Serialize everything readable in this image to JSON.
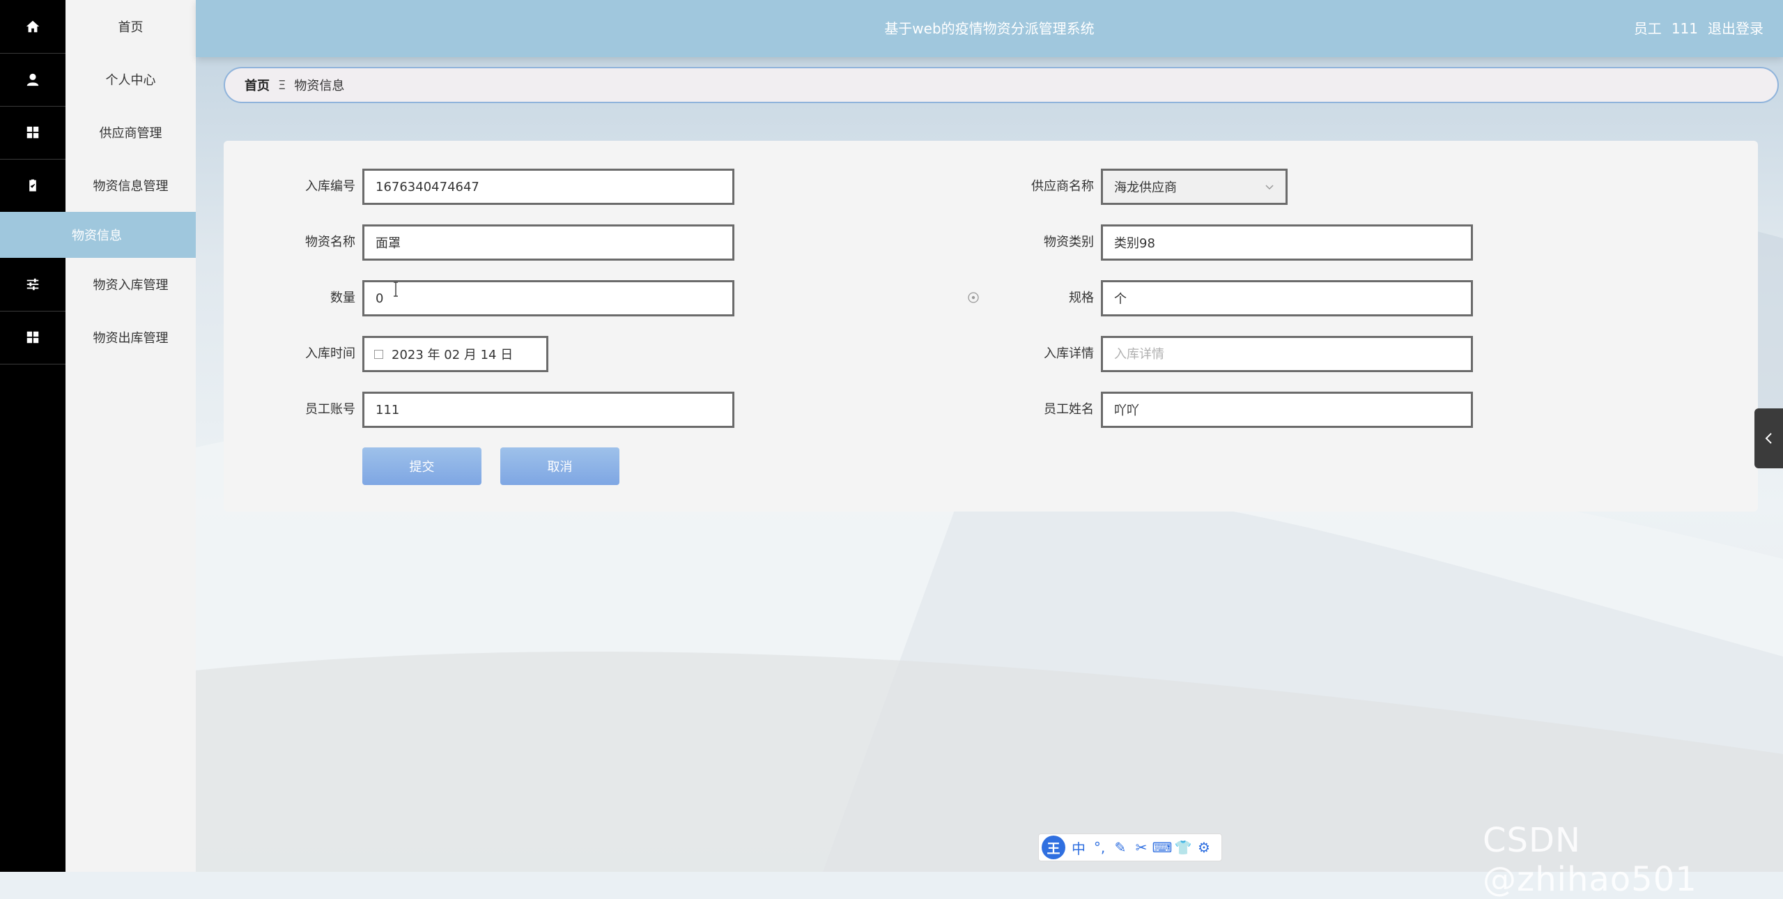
{
  "header": {
    "title": "基于web的疫情物资分派管理系统",
    "user_role": "员工",
    "user_name": "111",
    "logout": "退出登录"
  },
  "sidebar": {
    "items": [
      {
        "label": "首页",
        "icon": "home-icon"
      },
      {
        "label": "个人中心",
        "icon": "user-icon"
      },
      {
        "label": "供应商管理",
        "icon": "grid-icon"
      },
      {
        "label": "物资信息管理",
        "icon": "clipboard-icon"
      },
      {
        "label": "物资入库管理",
        "icon": "sliders-icon"
      },
      {
        "label": "物资出库管理",
        "icon": "grid-icon"
      }
    ],
    "active_sub_item": "物资信息"
  },
  "breadcrumb": {
    "home": "首页",
    "separator": "Ξ",
    "current": "物资信息"
  },
  "form": {
    "entry_no": {
      "label": "入库编号",
      "value": "1676340474647"
    },
    "supplier_name": {
      "label": "供应商名称",
      "value": "海龙供应商"
    },
    "material_name": {
      "label": "物资名称",
      "value": "面罩"
    },
    "material_category": {
      "label": "物资类别",
      "value": "类别98"
    },
    "quantity": {
      "label": "数量",
      "value": "0"
    },
    "spec": {
      "label": "规格",
      "value": "个"
    },
    "entry_time": {
      "label": "入库时间",
      "value": "2023 年 02 月 14 日"
    },
    "entry_detail": {
      "label": "入库详情",
      "value": "",
      "placeholder": "入库详情"
    },
    "staff_account": {
      "label": "员工账号",
      "value": "111"
    },
    "staff_name": {
      "label": "员工姓名",
      "value": "吖吖"
    },
    "submit": "提交",
    "cancel": "取消"
  },
  "ime_toolbar": {
    "logo": "王",
    "buttons": [
      "中",
      "°,",
      "✎",
      "✂",
      "⌨",
      "👕",
      "⚙"
    ]
  },
  "watermark": "CSDN @zhihao501",
  "colors": {
    "header_bg": "#a0c7dd",
    "active_menu_bg": "#9fc7dd",
    "button_blue": "#7ea6e3",
    "sidebar_rail": "#000000"
  }
}
